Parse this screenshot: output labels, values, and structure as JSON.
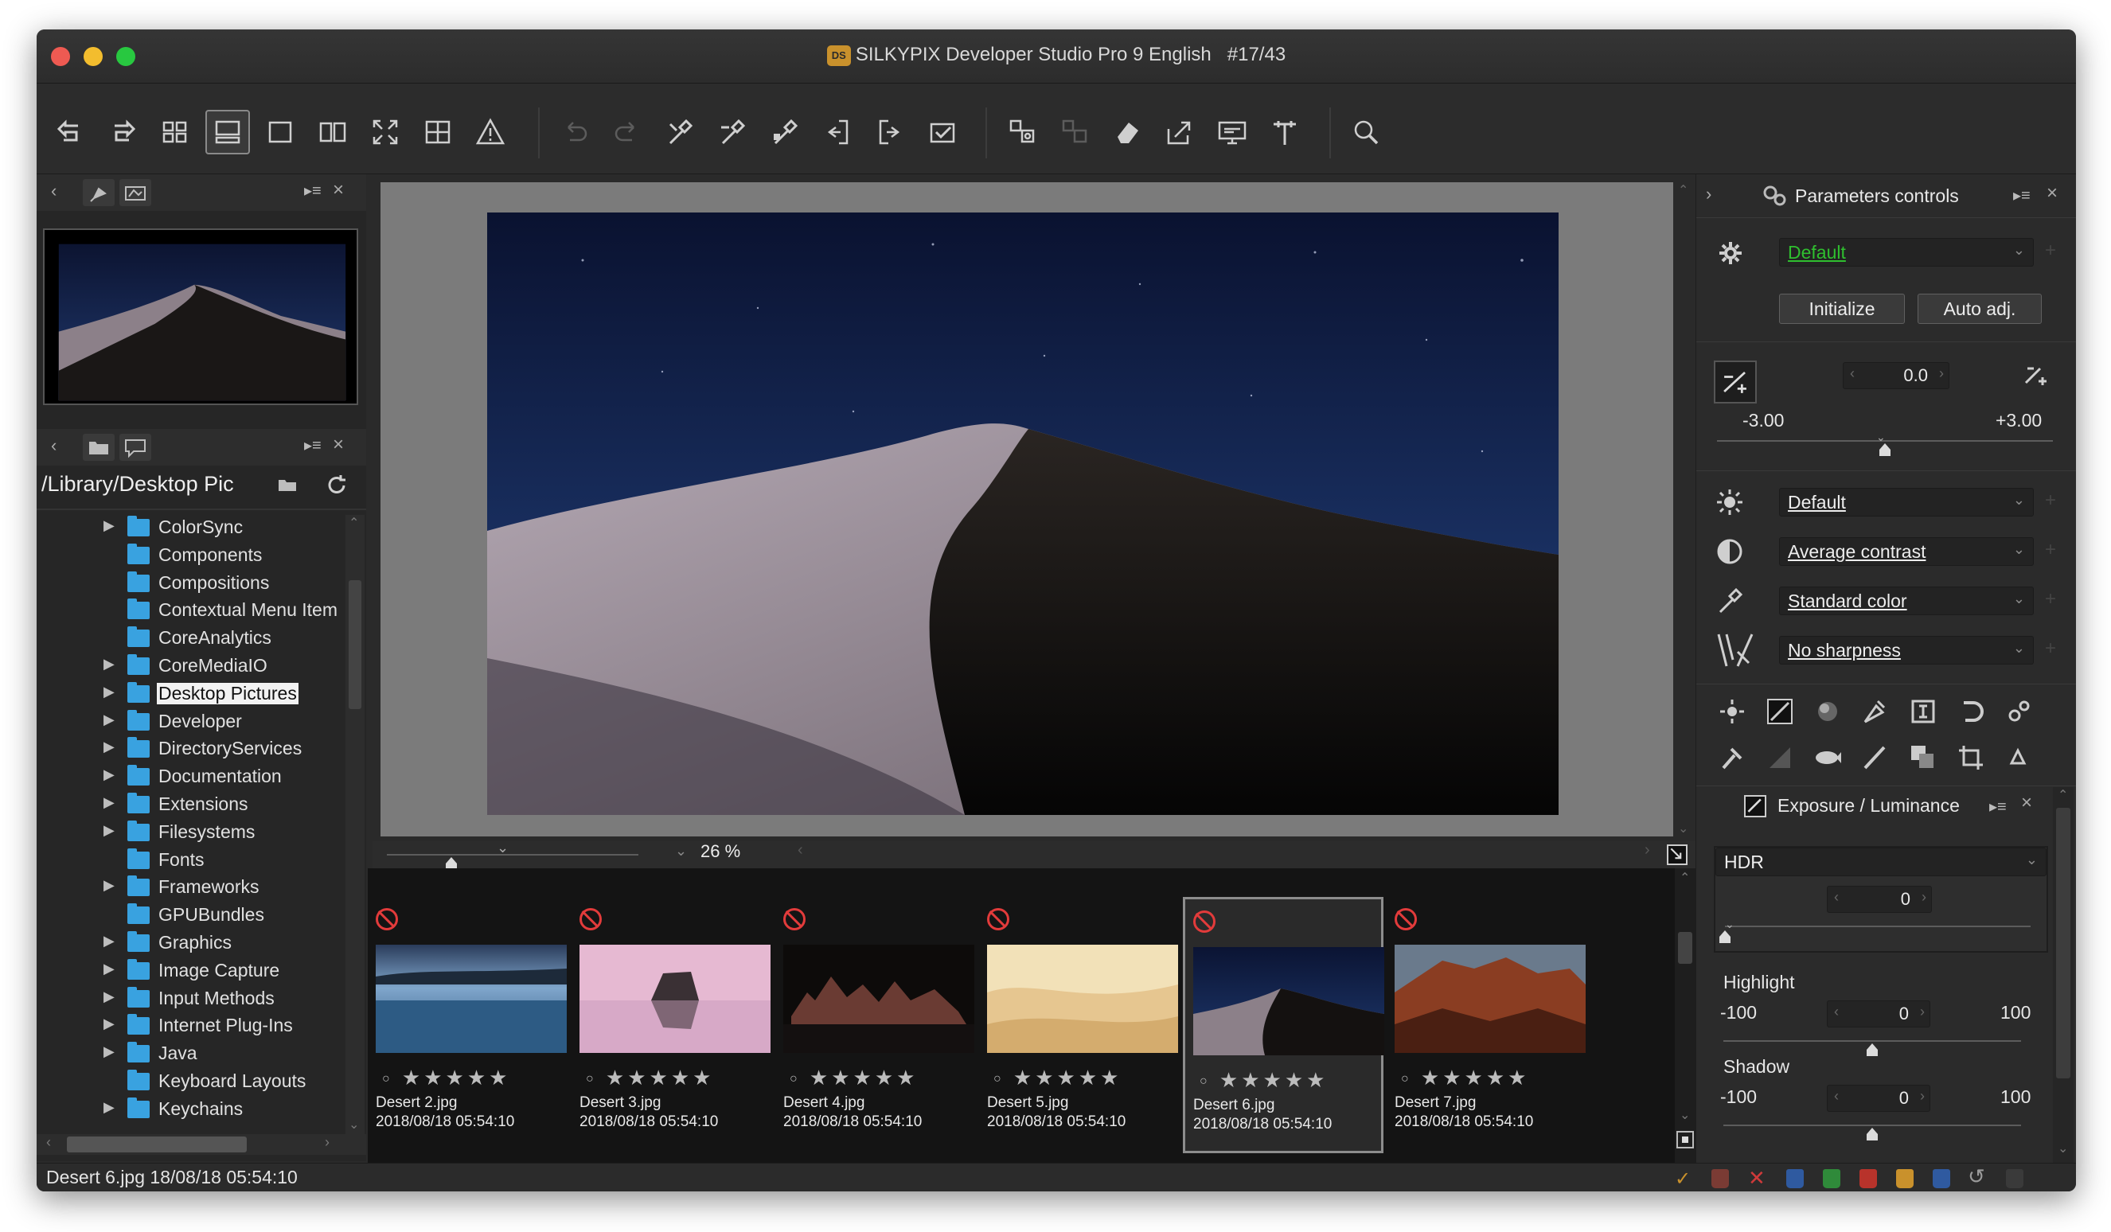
{
  "window": {
    "title": "SILKYPIX Developer Studio Pro 9 English",
    "counter": "#17/43",
    "app_badge": "DS"
  },
  "toolbar": {
    "icons": [
      "rotate-left-icon",
      "rotate-right-icon",
      "grid-view-icon",
      "preview-filmstrip-icon",
      "single-view-icon",
      "compare-view-icon",
      "fullscreen-icon",
      "grid-overlay-icon",
      "warning-icon",
      "undo-icon",
      "redo-icon",
      "pick-wb-icon",
      "pick-tone-icon",
      "pick-color-icon",
      "copy-params-icon",
      "paste-params-icon",
      "develop-check-icon",
      "batch-icon",
      "batch-disabled-icon",
      "eraser-icon",
      "export-icon",
      "monitor-icon",
      "hammer-icon",
      "zoom-search-icon"
    ]
  },
  "navigator": {
    "tab_pin_icon": "pin-icon",
    "tab_nav_icon": "navigator-icon"
  },
  "browser": {
    "path": "/Library/Desktop Pic",
    "folders": [
      {
        "label": "ColorSync",
        "expandable": true
      },
      {
        "label": "Components",
        "expandable": false
      },
      {
        "label": "Compositions",
        "expandable": false
      },
      {
        "label": "Contextual Menu Item",
        "expandable": false
      },
      {
        "label": "CoreAnalytics",
        "expandable": false
      },
      {
        "label": "CoreMediaIO",
        "expandable": true
      },
      {
        "label": "Desktop Pictures",
        "expandable": true,
        "selected": true
      },
      {
        "label": "Developer",
        "expandable": true
      },
      {
        "label": "DirectoryServices",
        "expandable": true
      },
      {
        "label": "Documentation",
        "expandable": true
      },
      {
        "label": "Extensions",
        "expandable": true
      },
      {
        "label": "Filesystems",
        "expandable": true
      },
      {
        "label": "Fonts",
        "expandable": false
      },
      {
        "label": "Frameworks",
        "expandable": true
      },
      {
        "label": "GPUBundles",
        "expandable": false
      },
      {
        "label": "Graphics",
        "expandable": true
      },
      {
        "label": "Image Capture",
        "expandable": true
      },
      {
        "label": "Input Methods",
        "expandable": true
      },
      {
        "label": "Internet Plug-Ins",
        "expandable": true
      },
      {
        "label": "Java",
        "expandable": true
      },
      {
        "label": "Keyboard Layouts",
        "expandable": false
      },
      {
        "label": "Keychains",
        "expandable": true
      }
    ]
  },
  "preview": {
    "zoom": "26",
    "zoom_unit": "%"
  },
  "thumbnails": [
    {
      "name": "Desert 2.jpg",
      "date": "2018/08/18 05:54:10",
      "rating": "★★★★★",
      "selected": false,
      "scene": "lake"
    },
    {
      "name": "Desert 3.jpg",
      "date": "2018/08/18 05:54:10",
      "rating": "★★★★★",
      "selected": false,
      "scene": "pink"
    },
    {
      "name": "Desert 4.jpg",
      "date": "2018/08/18 05:54:10",
      "rating": "★★★★★",
      "selected": false,
      "scene": "tufa"
    },
    {
      "name": "Desert 5.jpg",
      "date": "2018/08/18 05:54:10",
      "rating": "★★★★★",
      "selected": false,
      "scene": "sand"
    },
    {
      "name": "Desert 6.jpg",
      "date": "2018/08/18 05:54:10",
      "rating": "★★★★★",
      "selected": true,
      "scene": "dune"
    },
    {
      "name": "Desert 7.jpg",
      "date": "2018/08/18 05:54:10",
      "rating": "★★★★★",
      "selected": false,
      "scene": "rocks"
    }
  ],
  "params": {
    "title": "Parameters controls",
    "preset": "Default",
    "initialize": "Initialize",
    "auto_adj": "Auto adj.",
    "exposure_value": "0.0",
    "exposure_min": "-3.00",
    "exposure_max": "+3.00",
    "exposure_level": 0.5,
    "wb": "Default",
    "tone": "Average contrast",
    "color": "Standard color",
    "sharpness": "No sharpness",
    "accent": "#2fbf2f"
  },
  "exposure_panel": {
    "title": "Exposure / Luminance",
    "hdr_label": "HDR",
    "hdr_value": "0",
    "hdr_level": 0.0,
    "highlight_label": "Highlight",
    "highlight_min": "-100",
    "highlight_max": "100",
    "highlight_value": "0",
    "highlight_level": 0.5,
    "shadow_label": "Shadow",
    "shadow_min": "-100",
    "shadow_max": "100",
    "shadow_value": "0",
    "shadow_level": 0.5
  },
  "status": {
    "text": "Desert 6.jpg 18/08/18 05:54:10"
  }
}
